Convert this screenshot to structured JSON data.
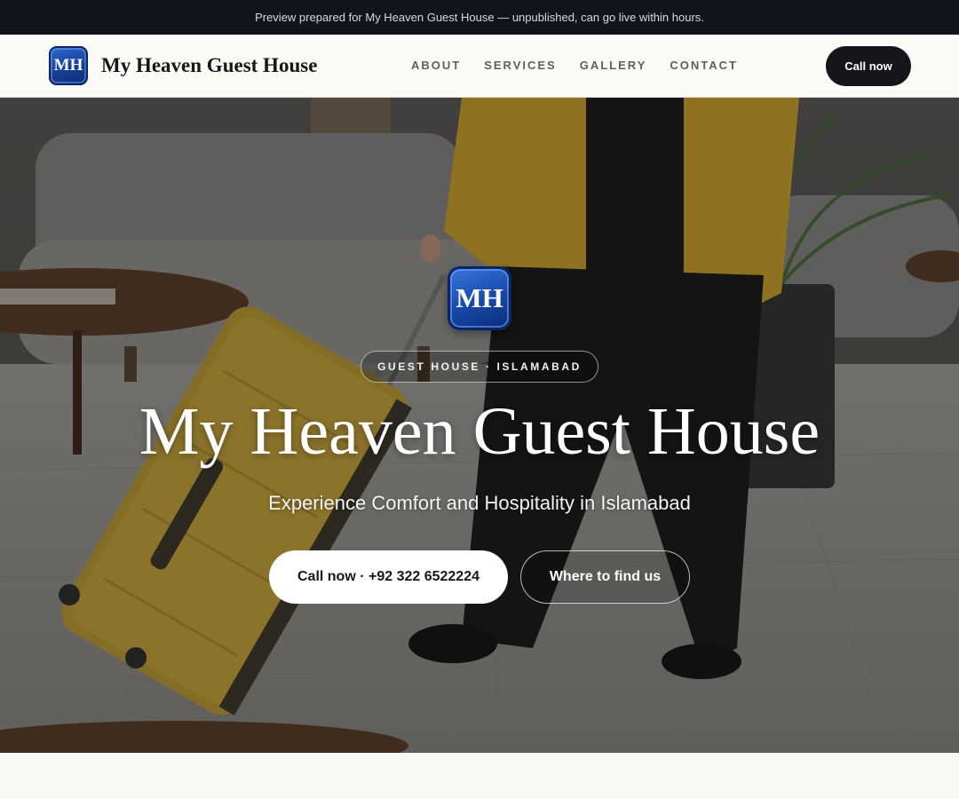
{
  "preview_banner": "Preview prepared for My Heaven Guest House — unpublished, can go live within hours.",
  "header": {
    "logo_initials": "MH",
    "brand_name": "My Heaven Guest House",
    "nav": [
      "ABOUT",
      "SERVICES",
      "GALLERY",
      "CONTACT"
    ],
    "call_button": "Call now"
  },
  "hero": {
    "logo_initials": "MH",
    "tag": "GUEST HOUSE · ISLAMABAD",
    "title": "My Heaven Guest House",
    "subtitle": "Experience Comfort and Hospitality in Islamabad",
    "primary_button": "Call now · +92 322 6522224",
    "secondary_button": "Where to find us"
  },
  "colors": {
    "banner_bg": "#11141a",
    "nav_bg": "#fbfaf7",
    "accent_dark": "#14161b",
    "logo_blue": "#163f98",
    "suitcase_yellow": "#c9a431",
    "jacket_yellow": "#d8ac2a"
  }
}
